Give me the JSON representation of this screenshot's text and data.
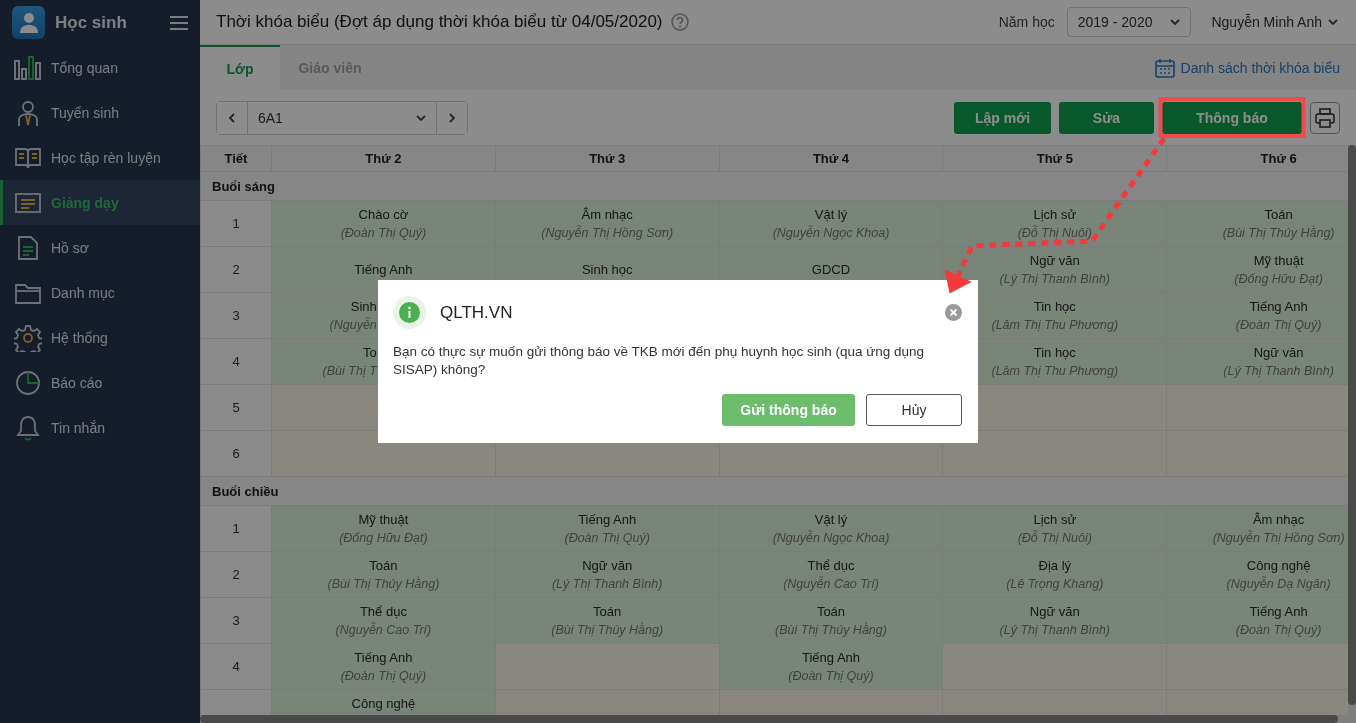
{
  "app": {
    "title": "Học sinh"
  },
  "sidebar": {
    "items": [
      {
        "label": "Tổng quan",
        "selected": false
      },
      {
        "label": "Tuyển sinh",
        "selected": false
      },
      {
        "label": "Học tập rèn luyện",
        "selected": false
      },
      {
        "label": "Giảng dạy",
        "selected": true
      },
      {
        "label": "Hồ sơ",
        "selected": false
      },
      {
        "label": "Danh mục",
        "selected": false
      },
      {
        "label": "Hệ thống",
        "selected": false
      },
      {
        "label": "Báo cáo",
        "selected": false
      },
      {
        "label": "Tin nhắn",
        "selected": false
      }
    ]
  },
  "header": {
    "title": "Thời khóa biểu (Đợt áp dụng thời khóa biểu từ 04/05/2020)",
    "school_year_label": "Năm học",
    "school_year": "2019 - 2020",
    "user": "Nguyễn Minh Anh"
  },
  "tabs": [
    {
      "label": "Lớp",
      "selected": true
    },
    {
      "label": "Giáo viên",
      "selected": false
    }
  ],
  "schedule_list_link": "Danh sách thời khóa biểu",
  "class_picker": {
    "value": "6A1"
  },
  "toolbar": {
    "buttons": [
      {
        "label": "Lập mới",
        "highlighted": false
      },
      {
        "label": "Sửa",
        "highlighted": false
      },
      {
        "label": "Thông báo",
        "highlighted": true
      }
    ]
  },
  "table": {
    "columns": [
      "Tiết",
      "Thứ 2",
      "Thứ 3",
      "Thứ 4",
      "Thứ 5",
      "Thứ 6"
    ],
    "sections": [
      {
        "title": "Buổi sáng",
        "rows": [
          {
            "period": "1",
            "cells": [
              {
                "subject": "Chào cờ",
                "teacher": "(Đoàn Thị Quý)"
              },
              {
                "subject": "Âm nhạc",
                "teacher": "(Nguyễn Thị Hồng Sơn)"
              },
              {
                "subject": "Vật lý",
                "teacher": "(Nguyễn Ngọc Khoa)"
              },
              {
                "subject": "Lịch sử",
                "teacher": "(Đỗ Thị Nuôi)"
              },
              {
                "subject": "Toán",
                "teacher": "(Bùi Thị Thúy Hằng)"
              }
            ]
          },
          {
            "period": "2",
            "cells": [
              {
                "subject": "Tiếng Anh"
              },
              {
                "subject": "Sinh học"
              },
              {
                "subject": "GDCD"
              },
              {
                "subject": "Ngữ văn",
                "teacher": "(Lý Thị Thanh Bình)"
              },
              {
                "subject": "Mỹ thuật",
                "teacher": "(Đống Hữu Đạt)"
              }
            ]
          },
          {
            "period": "3",
            "cells": [
              {
                "subject": "Sinh",
                "teacher": "(Nguyễn",
                "covered": true
              },
              null,
              null,
              {
                "subject": "Tin học",
                "teacher": "(Lâm Thị Thu Phương)"
              },
              {
                "subject": "Tiếng Anh",
                "teacher": "(Đoàn Thị Quý)"
              }
            ]
          },
          {
            "period": "4",
            "cells": [
              {
                "subject": "To",
                "teacher": "(Bùi Thị T",
                "covered": true
              },
              null,
              null,
              {
                "subject": "Tin học",
                "teacher": "(Lâm Thị Thu Phương)"
              },
              {
                "subject": "Ngữ văn",
                "teacher": "(Lý Thị Thanh Bình)"
              }
            ]
          },
          {
            "period": "5",
            "cells": [
              null,
              null,
              null,
              null,
              null
            ]
          },
          {
            "period": "6",
            "cells": [
              null,
              null,
              null,
              null,
              null
            ]
          }
        ]
      },
      {
        "title": "Buổi chiều",
        "rows": [
          {
            "period": "1",
            "cells": [
              {
                "subject": "Mỹ thuật",
                "teacher": "(Đống Hữu Đạt)"
              },
              {
                "subject": "Tiếng Anh",
                "teacher": "(Đoàn Thị Quý)"
              },
              {
                "subject": "Vật lý",
                "teacher": "(Nguyễn Ngọc Khoa)"
              },
              {
                "subject": "Lịch sử",
                "teacher": "(Đỗ Thị Nuôi)"
              },
              {
                "subject": "Âm nhạc",
                "teacher": "(Nguyễn Thị Hồng Sơn)"
              }
            ]
          },
          {
            "period": "2",
            "cells": [
              {
                "subject": "Toán",
                "teacher": "(Bùi Thị Thúy Hằng)"
              },
              {
                "subject": "Ngữ văn",
                "teacher": "(Lý Thị Thanh Bình)"
              },
              {
                "subject": "Thể dục",
                "teacher": "(Nguyễn Cao Trí)"
              },
              {
                "subject": "Địa lý",
                "teacher": "(Lê Trọng Khang)"
              },
              {
                "subject": "Công nghệ",
                "teacher": "(Nguyễn Dạ Ngân)"
              }
            ]
          },
          {
            "period": "3",
            "cells": [
              {
                "subject": "Thể dục",
                "teacher": "(Nguyễn Cao Trí)"
              },
              {
                "subject": "Toán",
                "teacher": "(Bùi Thị Thúy Hằng)"
              },
              {
                "subject": "Toán",
                "teacher": "(Bùi Thị Thúy Hằng)"
              },
              {
                "subject": "Ngữ văn",
                "teacher": "(Lý Thị Thanh Bình)"
              },
              {
                "subject": "Tiếng Anh",
                "teacher": "(Đoàn Thị Quý)"
              }
            ]
          },
          {
            "period": "4",
            "cells": [
              {
                "subject": "Tiếng Anh",
                "teacher": "(Đoàn Thị Quý)"
              },
              null,
              {
                "subject": "Tiếng Anh",
                "teacher": "(Đoàn Thị Quý)"
              },
              null,
              null
            ]
          },
          {
            "cells": [
              {
                "subject": "Công nghệ"
              },
              null,
              null,
              null,
              null
            ]
          }
        ]
      }
    ]
  },
  "dialog": {
    "title": "QLTH.VN",
    "message": "Bạn có thực sự muốn gửi thông báo về TKB mới đến phụ huynh học sinh (qua ứng dụng SISAP) không?",
    "buttons": [
      {
        "label": "Gửi thông báo",
        "kind": "primary"
      },
      {
        "label": "Hủy",
        "kind": "secondary"
      }
    ]
  }
}
